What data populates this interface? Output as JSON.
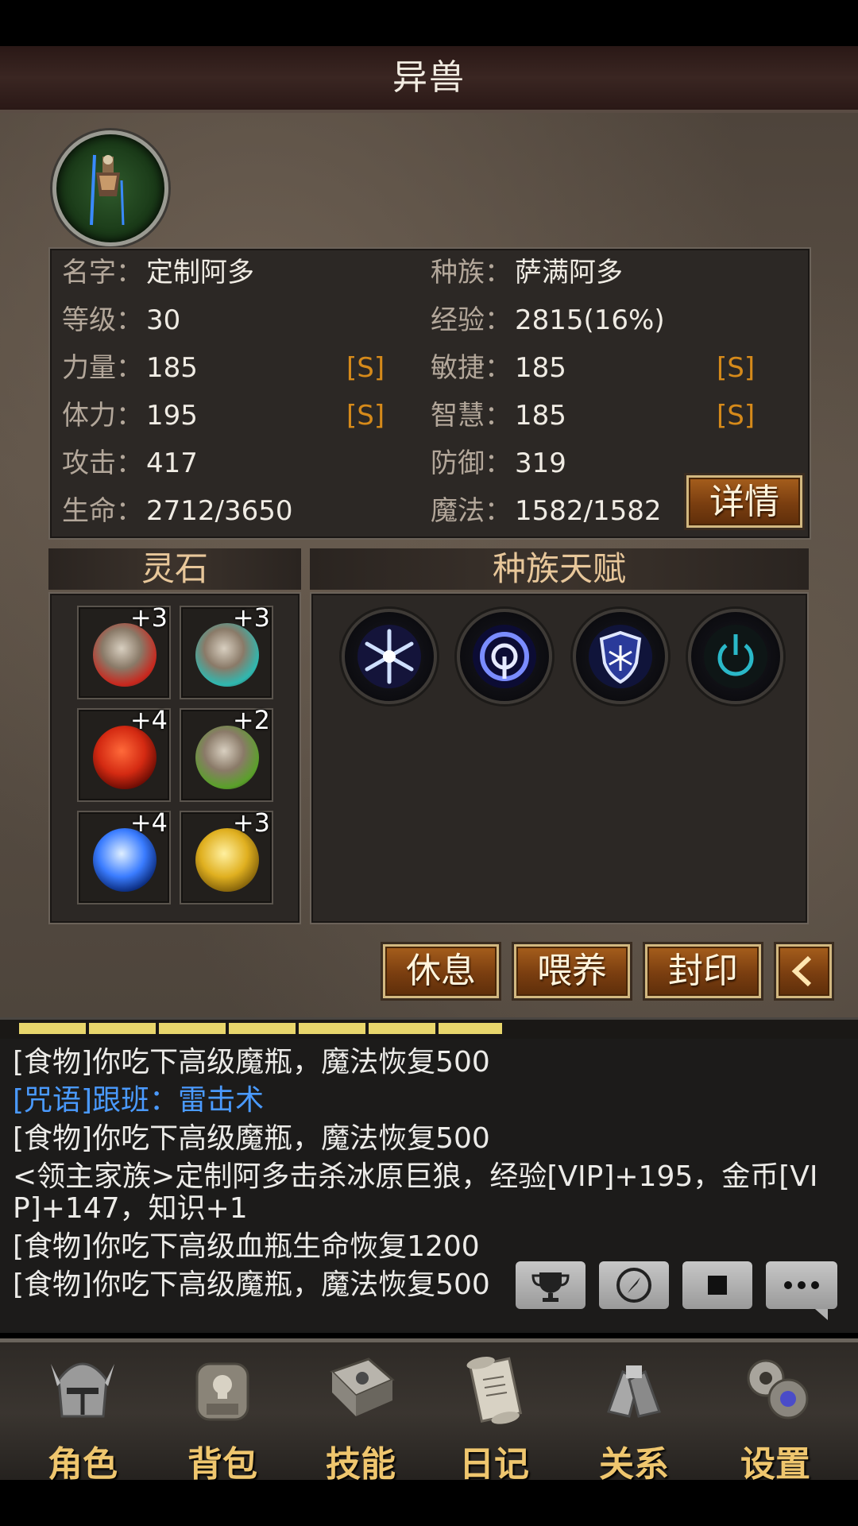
{
  "header": {
    "title": "异兽"
  },
  "stats": {
    "name_label": "名字：",
    "name_value": "定制阿多",
    "race_label": "种族：",
    "race_value": "萨满阿多",
    "level_label": "等级：",
    "level_value": "30",
    "exp_label": "经验：",
    "exp_value": "2815(16%)",
    "str_label": "力量：",
    "str_value": "185",
    "str_grade": "[S]",
    "agi_label": "敏捷：",
    "agi_value": "185",
    "agi_grade": "[S]",
    "sta_label": "体力：",
    "sta_value": "195",
    "sta_grade": "[S]",
    "wis_label": "智慧：",
    "wis_value": "185",
    "wis_grade": "[S]",
    "atk_label": "攻击：",
    "atk_value": "417",
    "def_label": "防御：",
    "def_value": "319",
    "hp_label": "生命：",
    "hp_value": "2712/3650",
    "mp_label": "魔法：",
    "mp_value": "1582/1582",
    "detail_button": "详情"
  },
  "spirit_stones": {
    "title": "灵石",
    "slots": [
      {
        "icon": "red-rune-stone-icon",
        "count": "+3",
        "color": "#c8281e"
      },
      {
        "icon": "teal-rune-stone-icon",
        "count": "+3",
        "color": "#2fb8b0"
      },
      {
        "icon": "red-orb-icon",
        "count": "+4",
        "color": "#d42a12"
      },
      {
        "icon": "green-rune-stone-icon",
        "count": "+2",
        "color": "#5aa02a"
      },
      {
        "icon": "blue-lightning-orb-icon",
        "count": "+4",
        "color": "#3a7cff"
      },
      {
        "icon": "gold-rune-stone-icon",
        "count": "+3",
        "color": "#e0b020"
      }
    ]
  },
  "race_talents": {
    "title": "种族天赋",
    "icons": [
      "snowflake-icon",
      "arcane-ring-icon",
      "frost-shield-icon",
      "power-ring-icon"
    ]
  },
  "actions": {
    "rest": "休息",
    "feed": "喂养",
    "seal": "封印",
    "back_icon": "chevron-left-icon"
  },
  "exp_progress": 0.58,
  "log": [
    {
      "text": "[食物]你吃下高级魔瓶，魔法恢复500",
      "type": "normal"
    },
    {
      "text": "[咒语]跟班：雷击术",
      "type": "spell"
    },
    {
      "text": "[食物]你吃下高级魔瓶，魔法恢复500",
      "type": "normal"
    },
    {
      "text": "<领主家族>定制阿多击杀冰原巨狼，经验[VIP]+195，金币[VIP]+147，知识+1",
      "type": "normal"
    },
    {
      "text": "[食物]你吃下高级血瓶生命恢复1200",
      "type": "normal"
    },
    {
      "text": "[食物]你吃下高级魔瓶，魔法恢复500",
      "type": "normal"
    }
  ],
  "chat_controls": [
    "trophy-icon",
    "compass-icon",
    "stop-icon",
    "chat-bubble-icon"
  ],
  "nav": [
    {
      "label": "角色",
      "icon": "helmet-icon"
    },
    {
      "label": "背包",
      "icon": "backpack-icon"
    },
    {
      "label": "技能",
      "icon": "spellbook-icon"
    },
    {
      "label": "日记",
      "icon": "scroll-icon"
    },
    {
      "label": "关系",
      "icon": "gauntlets-icon"
    },
    {
      "label": "设置",
      "icon": "gears-icon"
    }
  ]
}
